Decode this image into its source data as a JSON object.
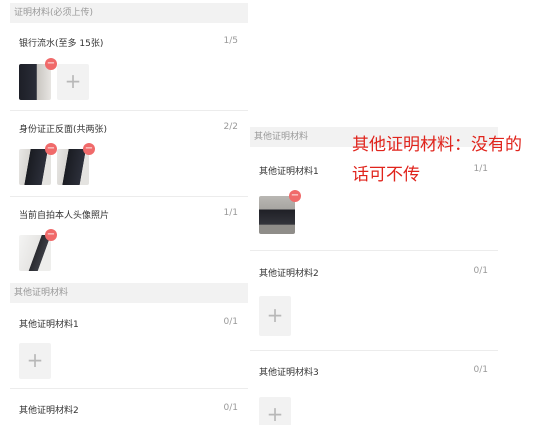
{
  "left": {
    "required_section": "证明材料(必须上传)",
    "bank": {
      "title": "银行流水(至多 15张)",
      "count": "1/5"
    },
    "idcard": {
      "title": "身份证正反面(共两张)",
      "count": "2/2"
    },
    "selfie": {
      "title": "当前自拍本人头像照片",
      "count": "1/1"
    },
    "other_section": "其他证明材料",
    "other1": {
      "title": "其他证明材料1",
      "count": "0/1"
    },
    "other2": {
      "title": "其他证明材料2",
      "count": "0/1"
    }
  },
  "right": {
    "other_section": "其他证明材料",
    "other1": {
      "title": "其他证明材料1",
      "count": "1/1"
    },
    "other2": {
      "title": "其他证明材料2",
      "count": "0/1"
    },
    "other3": {
      "title": "其他证明材料3",
      "count": "0/1"
    }
  },
  "note": "其他证明材料：没有的话可不传",
  "icons": {
    "delete": "minus-circle-icon",
    "add": "plus-icon"
  },
  "colors": {
    "accent_red": "#e0241c",
    "badge_red": "#f06a6a",
    "section_bg": "#f2f2f2"
  },
  "glyphs": {
    "minus": "−",
    "plus": "+"
  }
}
